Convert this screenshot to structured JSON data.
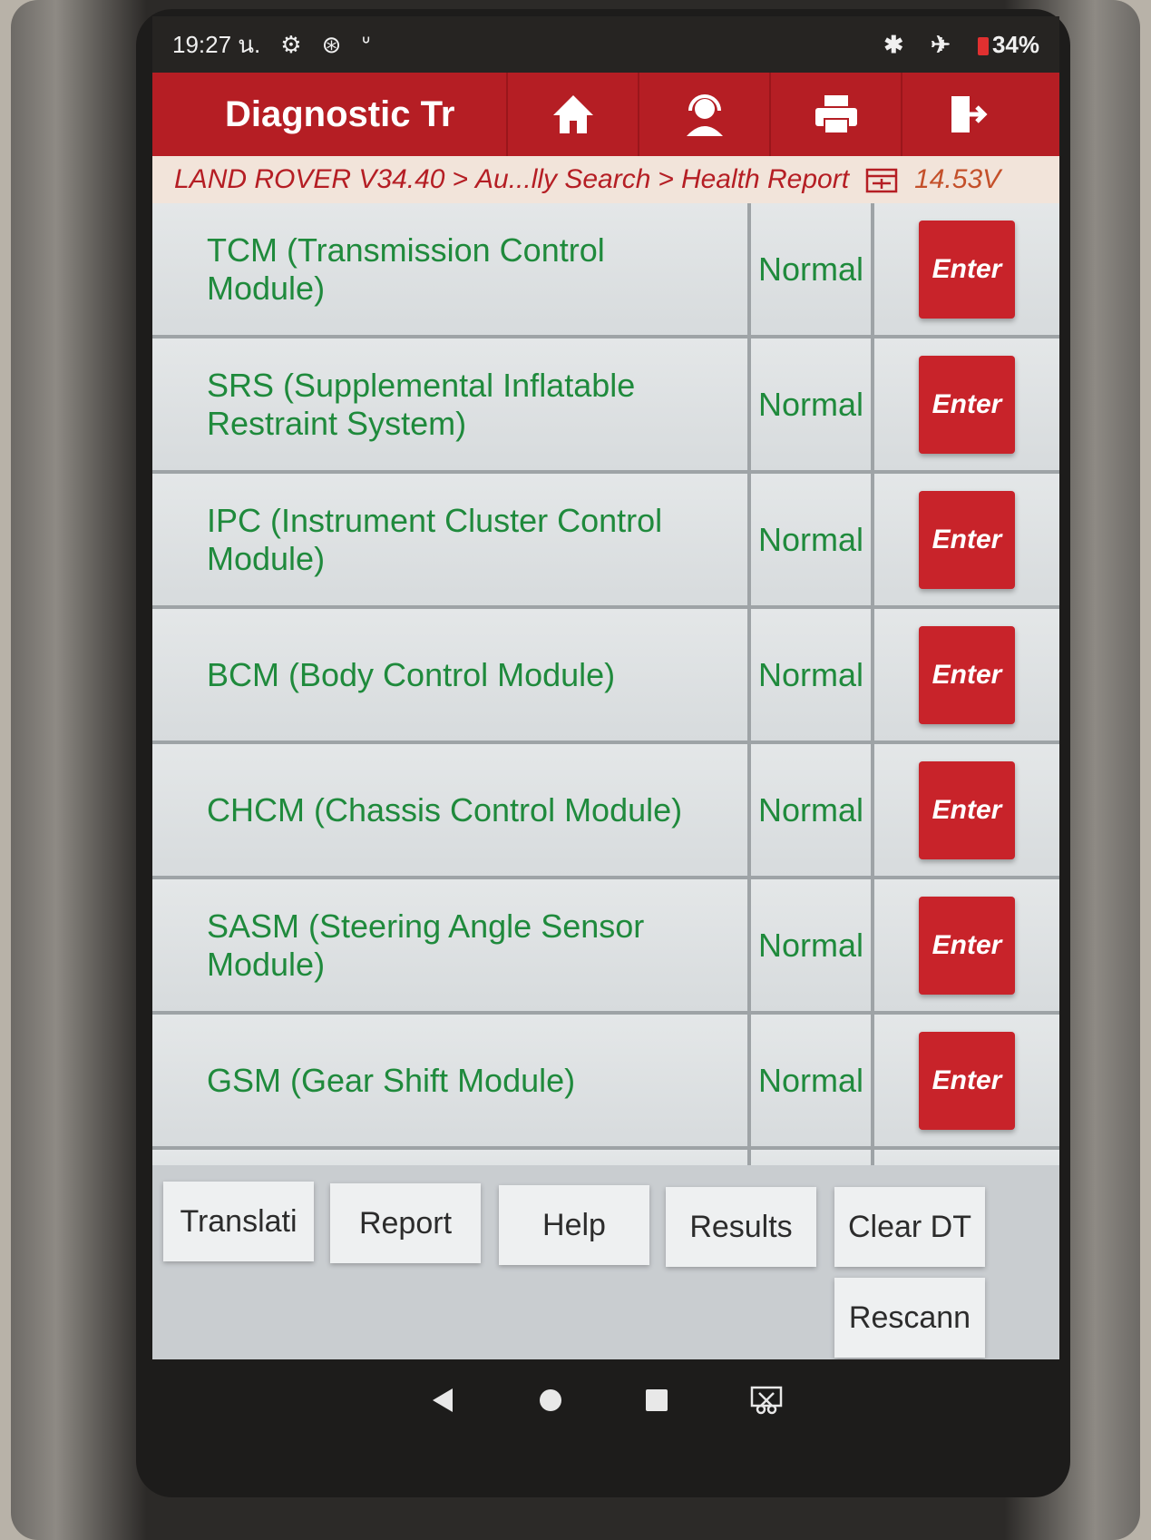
{
  "status_bar": {
    "time": "19:27 น.",
    "battery": "34%"
  },
  "header": {
    "title": "Diagnostic Tr",
    "buttons": [
      {
        "name": "home",
        "icon": "home-icon"
      },
      {
        "name": "support",
        "icon": "headset-icon"
      },
      {
        "name": "print",
        "icon": "printer-icon"
      },
      {
        "name": "exit",
        "icon": "exit-icon"
      }
    ]
  },
  "breadcrumb": {
    "items": [
      "LAND ROVER V34.40",
      "Au...lly Search",
      "Health Report"
    ],
    "separator": ">",
    "voltage": "14.53V"
  },
  "modules": [
    {
      "name": "TCM (Transmission Control Module)",
      "status": "Normal",
      "action": "Enter"
    },
    {
      "name": "SRS (Supplemental Inflatable Restraint System)",
      "status": "Normal",
      "action": "Enter"
    },
    {
      "name": "IPC (Instrument Cluster Control Module)",
      "status": "Normal",
      "action": "Enter"
    },
    {
      "name": "BCM (Body Control Module)",
      "status": "Normal",
      "action": "Enter"
    },
    {
      "name": "CHCM (Chassis Control Module)",
      "status": "Normal",
      "action": "Enter"
    },
    {
      "name": "SASM (Steering Angle Sensor Module)",
      "status": "Normal",
      "action": "Enter"
    },
    {
      "name": "GSM (Gear Shift Module)",
      "status": "Normal",
      "action": "Enter"
    }
  ],
  "toolbar": {
    "translation": "Translati",
    "report": "Report",
    "help": "Help",
    "results": "Results",
    "clear_dtc": "Clear DT",
    "rescan": "Rescann"
  },
  "colors": {
    "brand_red": "#b51e24",
    "status_green": "#1f8a3c"
  }
}
